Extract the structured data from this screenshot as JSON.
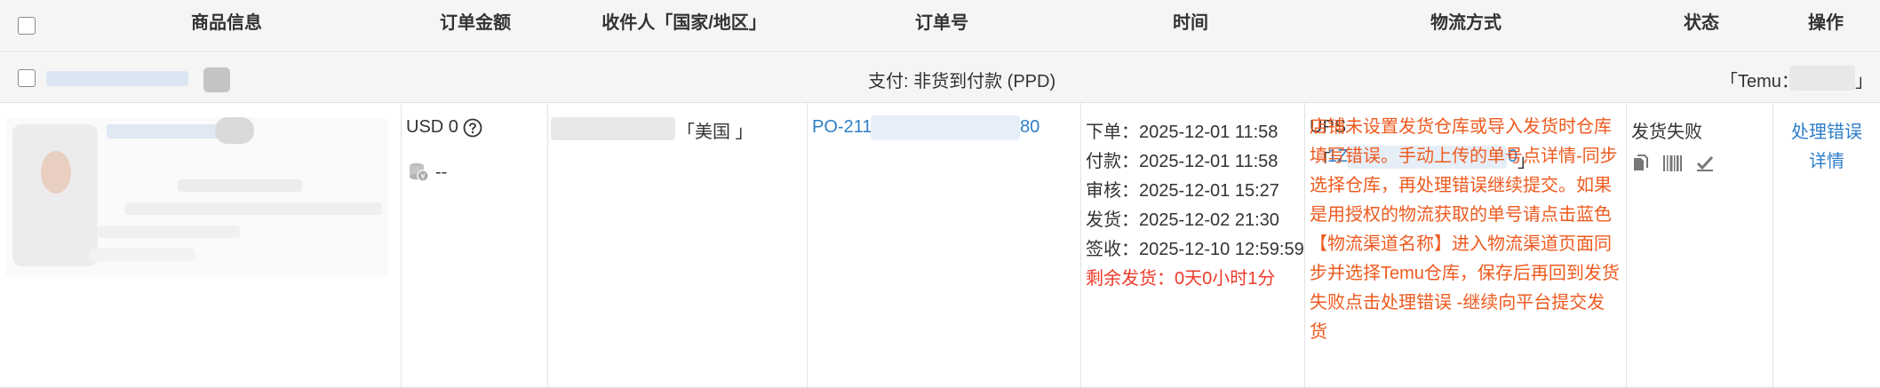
{
  "header": {
    "product_info": "商品信息",
    "order_amount": "订单金额",
    "recipient": "收件人「国家/地区」",
    "order_no": "订单号",
    "time": "时间",
    "shipping_method": "物流方式",
    "status": "状态",
    "actions": "操作"
  },
  "group": {
    "payment": "支付: 非货到付款 (PPD)",
    "platform_prefix": "「Temu：",
    "platform_suffix": "」"
  },
  "order": {
    "amount": "USD 0",
    "fee": "--",
    "country": "「美国 」",
    "po_prefix": "PO-211",
    "po_suffix": "80",
    "times": [
      {
        "label": "下单：",
        "value": "2025-12-01 11:58"
      },
      {
        "label": "付款：",
        "value": "2025-12-01 11:58"
      },
      {
        "label": "审核：",
        "value": "2025-12-01 15:27"
      },
      {
        "label": "发货：",
        "value": "2025-12-02 21:30"
      },
      {
        "label": "签收：",
        "value": "2025-12-10 12:59:59"
      }
    ],
    "remaining": "剩余发货：0天0小时1分",
    "carrier": "UPS",
    "tracking_prefix": "「",
    "tracking_start": "1Z(",
    "tracking_end": "0",
    "tracking_suffix": "」",
    "error_message": "店铺未设置发货仓库或导入发货时仓库填写错误。手动上传的单号点详情-同步选择仓库，再处理错误继续提交。如果是用授权的物流获取的单号请点击蓝色【物流渠道名称】进入物流渠道页面同步并选择Temu仓库，保存后再回到发货失败点击处理错误 -继续向平台提交发货",
    "status": "发货失败",
    "action_handle": "处理错误",
    "action_detail": "详情"
  },
  "icons": {
    "help": "question-circle-icon",
    "coin": "coin-stack-icon",
    "copy": "copy-icon",
    "barcode": "barcode-icon",
    "check": "checkmark-icon"
  },
  "colors": {
    "link": "#2f7fc9",
    "error": "#ee5a1f",
    "remaining": "#ee3a2b",
    "header_bg": "#f5f5f5"
  }
}
